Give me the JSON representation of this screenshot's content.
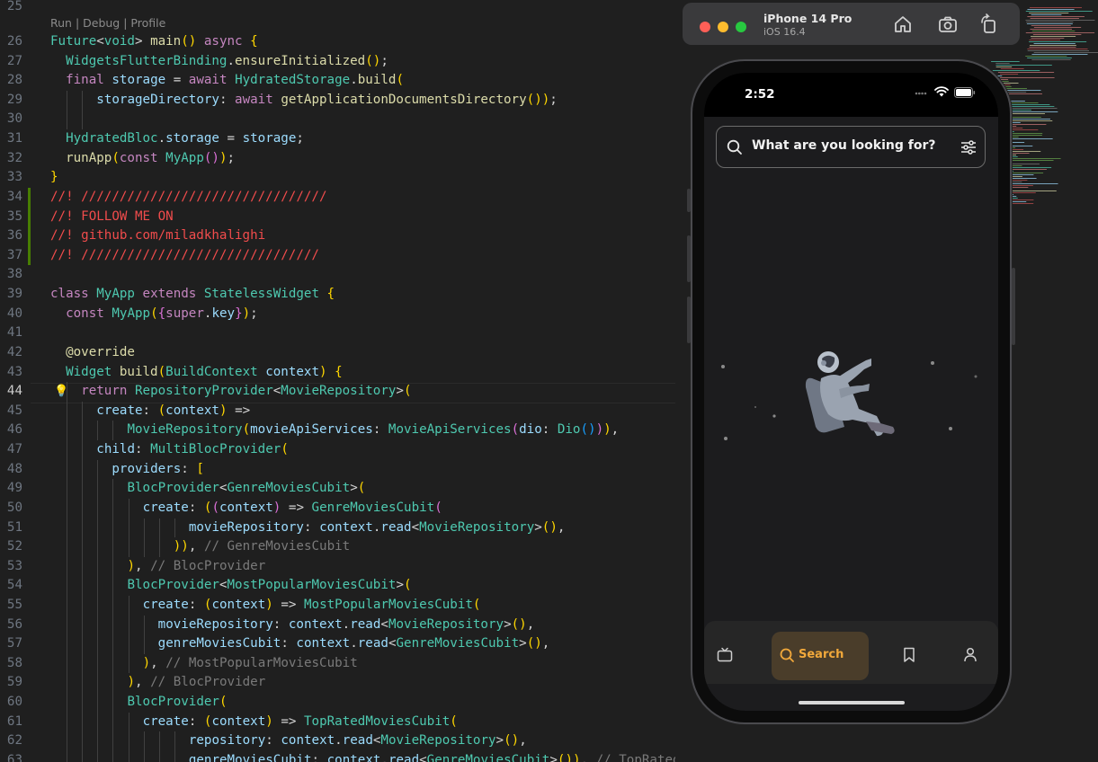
{
  "editor": {
    "codelens": "Run | Debug | Profile",
    "lines": [
      {
        "n": "25",
        "text": ""
      },
      {
        "n": "26",
        "text": "Future<void> main() async {"
      },
      {
        "n": "27",
        "text": "  WidgetsFlutterBinding.ensureInitialized();"
      },
      {
        "n": "28",
        "text": "  final storage = await HydratedStorage.build("
      },
      {
        "n": "29",
        "text": "      storageDirectory: await getApplicationDocumentsDirectory());"
      },
      {
        "n": "30",
        "text": ""
      },
      {
        "n": "31",
        "text": "  HydratedBloc.storage = storage;"
      },
      {
        "n": "32",
        "text": "  runApp(const MyApp());"
      },
      {
        "n": "33",
        "text": "}"
      },
      {
        "n": "34",
        "text": "//! ////////////////////////////////"
      },
      {
        "n": "35",
        "text": "//! FOLLOW ME ON"
      },
      {
        "n": "36",
        "text": "//! github.com/miladkhalighi"
      },
      {
        "n": "37",
        "text": "//! ///////////////////////////////"
      },
      {
        "n": "38",
        "text": ""
      },
      {
        "n": "39",
        "text": "class MyApp extends StatelessWidget {"
      },
      {
        "n": "40",
        "text": "  const MyApp({super.key});"
      },
      {
        "n": "41",
        "text": ""
      },
      {
        "n": "42",
        "text": "  @override"
      },
      {
        "n": "43",
        "text": "  Widget build(BuildContext context) {"
      },
      {
        "n": "44",
        "text": "    return RepositoryProvider<MovieRepository>("
      },
      {
        "n": "45",
        "text": "      create: (context) =>"
      },
      {
        "n": "46",
        "text": "          MovieRepository(movieApiServices: MovieApiServices(dio: Dio())),"
      },
      {
        "n": "47",
        "text": "      child: MultiBlocProvider("
      },
      {
        "n": "48",
        "text": "        providers: ["
      },
      {
        "n": "49",
        "text": "          BlocProvider<GenreMoviesCubit>("
      },
      {
        "n": "50",
        "text": "            create: ((context) => GenreMoviesCubit("
      },
      {
        "n": "51",
        "text": "                  movieRepository: context.read<MovieRepository>(),"
      },
      {
        "n": "52",
        "text": "                )), // GenreMoviesCubit"
      },
      {
        "n": "53",
        "text": "          ), // BlocProvider"
      },
      {
        "n": "54",
        "text": "          BlocProvider<MostPopularMoviesCubit>("
      },
      {
        "n": "55",
        "text": "            create: (context) => MostPopularMoviesCubit("
      },
      {
        "n": "56",
        "text": "              movieRepository: context.read<MovieRepository>(),"
      },
      {
        "n": "57",
        "text": "              genreMoviesCubit: context.read<GenreMoviesCubit>(),"
      },
      {
        "n": "58",
        "text": "            ), // MostPopularMoviesCubit"
      },
      {
        "n": "59",
        "text": "          ), // BlocProvider"
      },
      {
        "n": "60",
        "text": "          BlocProvider("
      },
      {
        "n": "61",
        "text": "            create: (context) => TopRatedMoviesCubit("
      },
      {
        "n": "62",
        "text": "                  repository: context.read<MovieRepository>(),"
      },
      {
        "n": "63",
        "text": "                  genreMoviesCubit: context.read<GenreMoviesCubit>()), // TopRatedMoviesCubit"
      }
    ]
  },
  "simulator": {
    "device_name": "iPhone 14 Pro",
    "os_version": "iOS 16.4",
    "toolbar_icons": [
      "home-icon",
      "screenshot-icon",
      "rotate-icon"
    ]
  },
  "app": {
    "status_time": "2:52",
    "search_placeholder": "What are you looking for?",
    "nav": [
      {
        "icon": "tv-icon",
        "label": ""
      },
      {
        "icon": "search-icon",
        "label": "Search",
        "active": true
      },
      {
        "icon": "bookmark-icon",
        "label": ""
      },
      {
        "icon": "profile-icon",
        "label": ""
      }
    ],
    "colors": {
      "accent": "#f2a93b",
      "active_tab_bg": "#4a3d2a",
      "background": "#1c1c1e"
    }
  }
}
